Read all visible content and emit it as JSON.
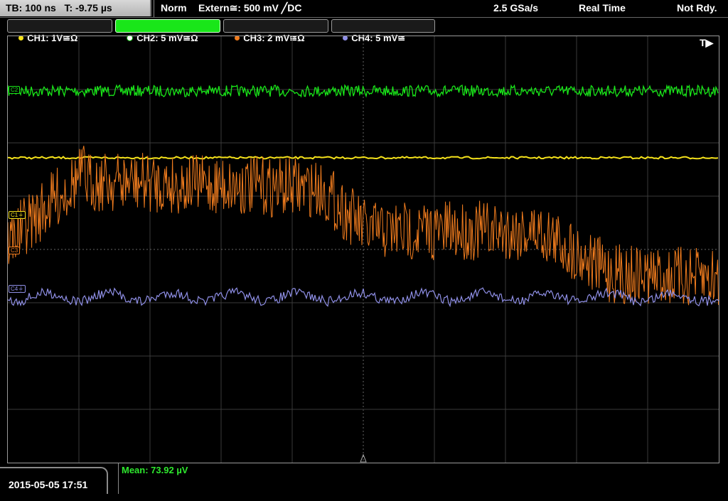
{
  "status": {
    "timebase": "TB: 100 ns",
    "trigger_time": "T: -9.75 µs",
    "mode": "Norm",
    "trigger_source": "Extern≅: 500 mV ╱DC",
    "sample_rate": "2.5 GSa/s",
    "acq_mode": "Real Time",
    "state": "Not Rdy."
  },
  "channels": [
    {
      "label": "CH1: 1V≅Ω",
      "color": "#f5e21b"
    },
    {
      "label": "CH2: 5 mV≅Ω",
      "color": "#19e619",
      "active": true
    },
    {
      "label": "CH3: 2 mV≅Ω",
      "color": "#f07c1e"
    },
    {
      "label": "CH4: 5 mV≅",
      "color": "#8f8fe6"
    }
  ],
  "markers": {
    "c1": "C1⏚",
    "c2": "C2",
    "c3": "C3",
    "c4": "C4⏚"
  },
  "trigger_marker": "T▶",
  "date": "2015-05-05 17:51",
  "measurement": "Mean: 73.92 µV"
}
